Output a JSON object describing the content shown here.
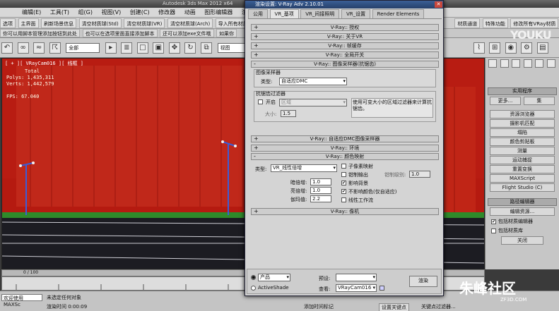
{
  "app": {
    "title": "Autodesk 3ds Max  2012 x64",
    "menus": [
      "编辑(E)",
      "工具(T)",
      "组(G)",
      "视图(V)",
      "创建(C)",
      "修改器",
      "动画",
      "图形编辑器",
      "渲染(R)"
    ]
  },
  "toolbar1": [
    "选项",
    "主界面",
    "刷新场景信息",
    "清空材质球(Std)",
    "清空材质球(VR)",
    "清空材质球(Arch)",
    "导入所有材质",
    "材质通道",
    "特殊功能",
    "修改所有VRay材质"
  ],
  "toolbar2": [
    "你可以用脚本管理添加按钮到此处",
    "也可以在选项里面直接添加脚本",
    "还可以添加exe文件哦",
    "如果你"
  ],
  "toolbar3": {
    "filter": "全部",
    "view": "视图"
  },
  "viewport": {
    "label": "[ + ][ VRayCam016 ][ 线框 ]",
    "stats_title": "Total",
    "polys": "Polys: 1,435,311",
    "verts": "Verts: 1,442,579",
    "fps": "FPS:  67.040"
  },
  "command_panel": {
    "utilities_header": "实用程序",
    "more": "更多...",
    "sets": "集",
    "buttons": [
      "资源浏览器",
      "摄影机匹配",
      "塌陷",
      "颜色剪贴板",
      "测量",
      "运动捕捉",
      "重置变换",
      "MAXScript",
      "Flight Studio (C)"
    ],
    "path_header": "路径编辑器",
    "edit_resources": "编辑资源...",
    "check1": "包括材质编辑器",
    "check2": "包括材质库",
    "close": "关闭"
  },
  "timeline": {
    "frame": "0 / 100"
  },
  "status": {
    "welcome": "欢迎使用  MAXSc",
    "no_selection": "未选定任何对象",
    "render_time": "渲染时间  0:00:09",
    "add_time_tag": "添加时间标记",
    "set_key": "设置关键点",
    "key_filter": "关键点过滤器..."
  },
  "dialog": {
    "title": "渲染设置: V-Ray Adv 2.10.01",
    "tabs": [
      "公用",
      "VR_基项",
      "VR_间接照明",
      "VR_设置",
      "Render Elements"
    ],
    "rollouts": {
      "auth": "V-Ray:: 授权",
      "about": "V-Ray:: 关于VR",
      "framebuffer": "V-Ray:: 帧缓存",
      "global": "V-Ray:: 全局开关",
      "image_sampler": "V-Ray:: 图像采样器(抗锯齿)",
      "adaptive_dmc": "V-Ray:: 自适应DMC图像采样器",
      "environment": "V-Ray:: 环境",
      "color_mapping": "V-Ray:: 颜色映射",
      "camera": "V-Ray:: 像机"
    },
    "image_sampler": {
      "group": "图像采样器",
      "type_label": "类型:",
      "type_value": "自适应DMC",
      "aa_group": "抗锯齿过滤器",
      "on_label": "开启",
      "filter_value": "区域",
      "desc": "使用可变大小的区域过滤器来计算抗锯齿。",
      "size_label": "大小:",
      "size_value": "1.5"
    },
    "color_mapping": {
      "type_label": "类型:",
      "type_value": "VR_线性倍增",
      "dark_label": "暗倍增:",
      "dark_value": "1.0",
      "bright_label": "亮倍增:",
      "bright_value": "1.0",
      "gamma_label": "伽玛值:",
      "gamma_value": "2.2",
      "subpixel": "子像素映射",
      "clamp": "钳制输出",
      "clamp_level_label": "钳制级别:",
      "clamp_level_value": "1.0",
      "affect_bg": "影响背景",
      "no_affect": "不影响颜色(仅自适应)",
      "linear": "线性工作流"
    },
    "bottom": {
      "product": "产品",
      "activeshade": "ActiveShade",
      "preset_label": "预设:",
      "view_label": "查看:",
      "view_value": "VRayCam016",
      "render": "渲染"
    }
  },
  "watermarks": {
    "youku": "YOUKU",
    "zf3d": "朱峰社区",
    "zf3d_url": "ZF3D.COM"
  }
}
